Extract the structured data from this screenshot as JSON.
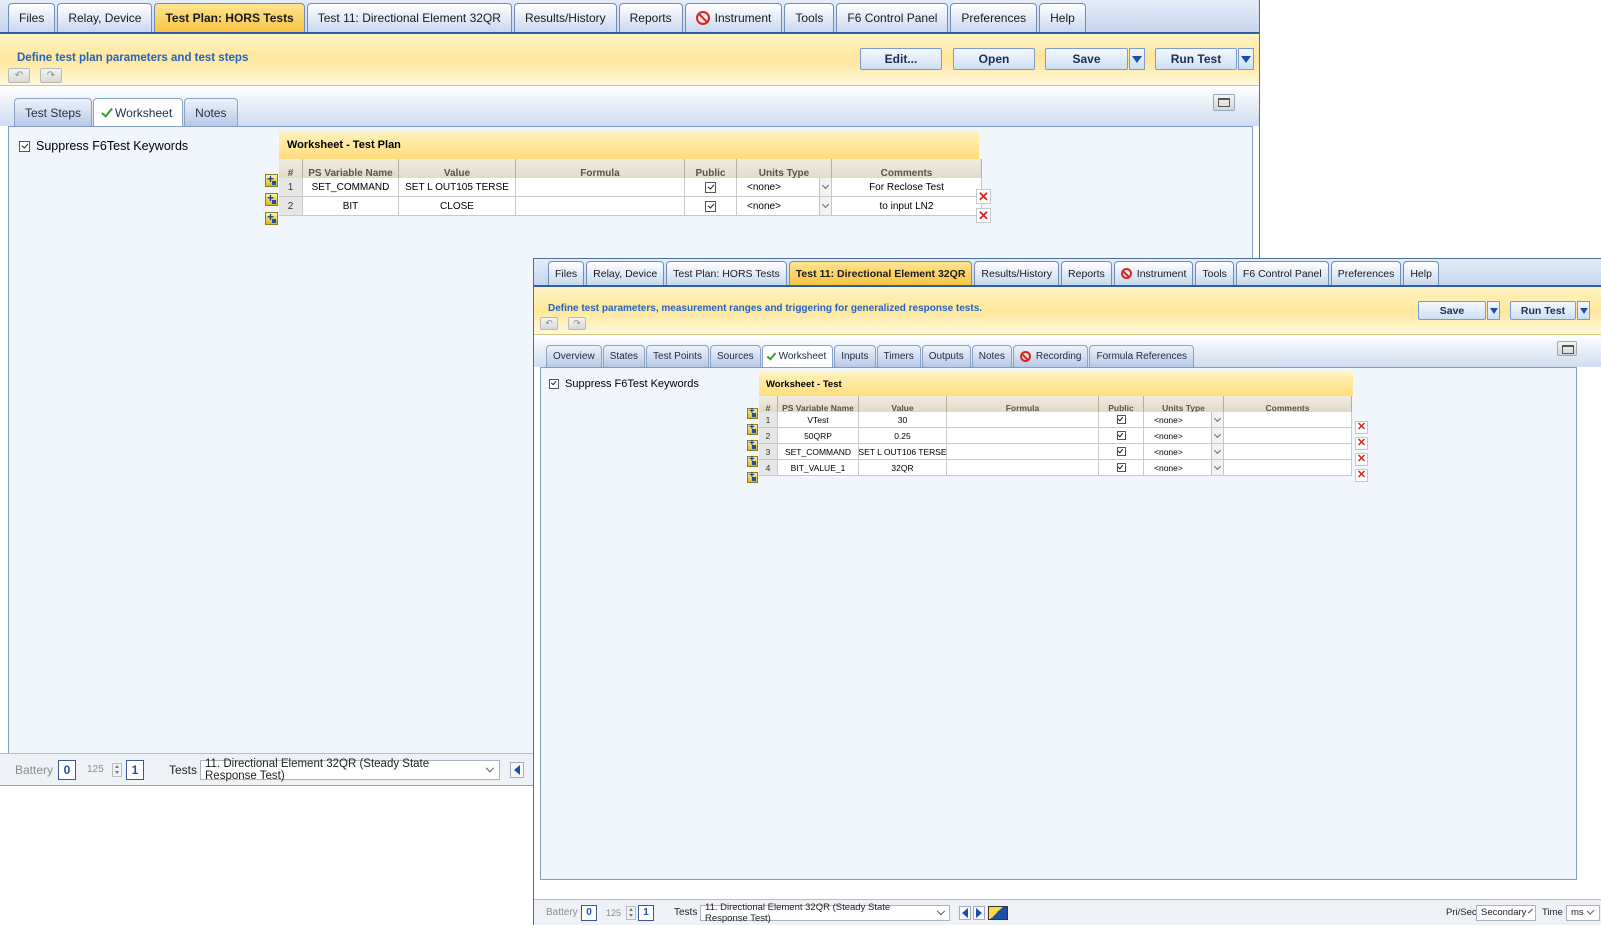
{
  "main_tabs_back": [
    "Files",
    "Relay, Device",
    "Test Plan: HORS Tests",
    "Test 11:  Directional Element 32QR",
    "Results/History",
    "Reports",
    "Instrument",
    "Tools",
    "F6 Control Panel",
    "Preferences",
    "Help"
  ],
  "main_tabs_front": [
    "Files",
    "Relay, Device",
    "Test Plan: HORS Tests",
    "Test 11:  Directional Element 32QR",
    "Results/History",
    "Reports",
    "Instrument",
    "Tools",
    "F6 Control Panel",
    "Preferences",
    "Help"
  ],
  "back_window": {
    "header": "Define test plan parameters and test steps",
    "buttons": {
      "edit": "Edit...",
      "open": "Open",
      "save": "Save",
      "run": "Run Test"
    },
    "subtabs": [
      "Test Steps",
      "Worksheet",
      "Notes"
    ],
    "suppress_label": "Suppress F6Test Keywords",
    "worksheet_title": "Worksheet - Test Plan",
    "columns": [
      "#",
      "PS Variable Name",
      "Value",
      "Formula",
      "Public",
      "Units Type",
      "Comments"
    ],
    "rows": [
      {
        "num": "1",
        "name": "SET_COMMAND",
        "value": "SET L OUT105 TERSE",
        "formula": "",
        "units": "<none>",
        "comment": "For Reclose Test"
      },
      {
        "num": "2",
        "name": "BIT",
        "value": "CLOSE",
        "formula": "",
        "units": "<none>",
        "comment": "to input LN2"
      }
    ],
    "status": {
      "battery_label": "Battery",
      "battery_value": "0",
      "count": "125",
      "index": "1",
      "tests_label": "Tests",
      "tests_value": "11. Directional Element 32QR (Steady State Response Test)"
    }
  },
  "front_window": {
    "header": "Define test parameters, measurement ranges and triggering for generalized response tests.",
    "buttons": {
      "save": "Save",
      "run": "Run Test"
    },
    "subtabs": [
      "Overview",
      "States",
      "Test Points",
      "Sources",
      "Worksheet",
      "Inputs",
      "Timers",
      "Outputs",
      "Notes",
      "Recording",
      "Formula References"
    ],
    "suppress_label": "Suppress F6Test Keywords",
    "worksheet_title": "Worksheet - Test",
    "columns": [
      "#",
      "PS Variable Name",
      "Value",
      "Formula",
      "Public",
      "Units Type",
      "Comments"
    ],
    "rows": [
      {
        "num": "1",
        "name": "VTest",
        "value": "30",
        "formula": "",
        "units": "<none>",
        "comment": ""
      },
      {
        "num": "2",
        "name": "50QRP",
        "value": "0.25",
        "formula": "",
        "units": "<none>",
        "comment": ""
      },
      {
        "num": "3",
        "name": "SET_COMMAND",
        "value": "SET L OUT106 TERSE",
        "formula": "",
        "units": "<none>",
        "comment": ""
      },
      {
        "num": "4",
        "name": "BIT_VALUE_1",
        "value": "32QR",
        "formula": "",
        "units": "<none>",
        "comment": ""
      }
    ],
    "status": {
      "battery_label": "Battery",
      "battery_value": "0",
      "count": "125",
      "index": "1",
      "tests_label": "Tests",
      "tests_value": "11. Directional Element 32QR (Steady State Response Test)",
      "prisec_label": "Pri/Sec",
      "prisec_value": "Secondary",
      "time_label": "Time",
      "time_value": "ms"
    }
  },
  "icons": {
    "undo": "undo-icon",
    "redo": "redo-icon",
    "instrument": "no-entry-icon",
    "recording": "no-entry-icon",
    "worksheet": "checkmark-icon",
    "insert": "insert-row-icon",
    "delete": "delete-x-icon",
    "restore": "window-restore-icon"
  },
  "colors": {
    "active_tab": "#f7c342",
    "header_text": "#2163c8",
    "accent_blue": "#2e5fa8",
    "delete_red": "#d8261e"
  }
}
